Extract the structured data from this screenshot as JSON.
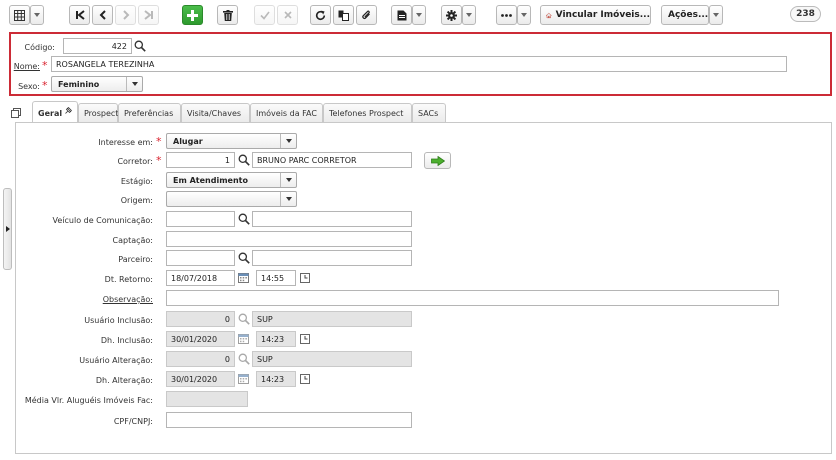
{
  "toolbar": {
    "vincular_label": "Vincular Imóveis...",
    "acoes_label": "Ações...",
    "record_count": "238"
  },
  "header": {
    "codigo": {
      "label": "Código:",
      "value": "422"
    },
    "nome": {
      "label": "Nome:",
      "value": "ROSANGELA TEREZINHA"
    },
    "sexo": {
      "label": "Sexo:",
      "value": "Feminino"
    }
  },
  "tabs": [
    {
      "label": "Geral",
      "active": true
    },
    {
      "label": "Prospect"
    },
    {
      "label": "Preferências"
    },
    {
      "label": "Visita/Chaves"
    },
    {
      "label": "Imóveis da FAC"
    },
    {
      "label": "Telefones Prospect"
    },
    {
      "label": "SACs"
    }
  ],
  "form": {
    "interesse": {
      "label": "Interesse em:",
      "value": "Alugar"
    },
    "corretor": {
      "label": "Corretor:",
      "code": "1",
      "name": "BRUNO PARC CORRETOR"
    },
    "estagio": {
      "label": "Estágio:",
      "value": "Em Atendimento"
    },
    "origem": {
      "label": "Origem:",
      "value": ""
    },
    "veiculo": {
      "label": "Veículo de Comunicação:",
      "code": "",
      "name": ""
    },
    "captacao": {
      "label": "Captação:",
      "value": ""
    },
    "parceiro": {
      "label": "Parceiro:",
      "code": "",
      "name": ""
    },
    "dt_retorno": {
      "label": "Dt. Retorno:",
      "date": "18/07/2018",
      "time": "14:55"
    },
    "observacao": {
      "label": "Observação:",
      "value": ""
    },
    "usuario_inclusao": {
      "label": "Usuário Inclusão:",
      "code": "0",
      "name": "SUP"
    },
    "dh_inclusao": {
      "label": "Dh. Inclusão:",
      "date": "30/01/2020",
      "time": "14:23"
    },
    "usuario_alteracao": {
      "label": "Usuário Alteração:",
      "code": "0",
      "name": "SUP"
    },
    "dh_alteracao": {
      "label": "Dh. Alteração:",
      "date": "30/01/2020",
      "time": "14:23"
    },
    "media_vlr": {
      "label": "Média Vlr. Aluguéis Imóveis Fac:",
      "value": ""
    },
    "cpf_cnpj": {
      "label": "CPF/CNPJ:",
      "value": ""
    }
  },
  "colors": {
    "accent_green": "#2e9a2e",
    "required_red": "#d9232f",
    "header_border": "#cc2b36"
  }
}
